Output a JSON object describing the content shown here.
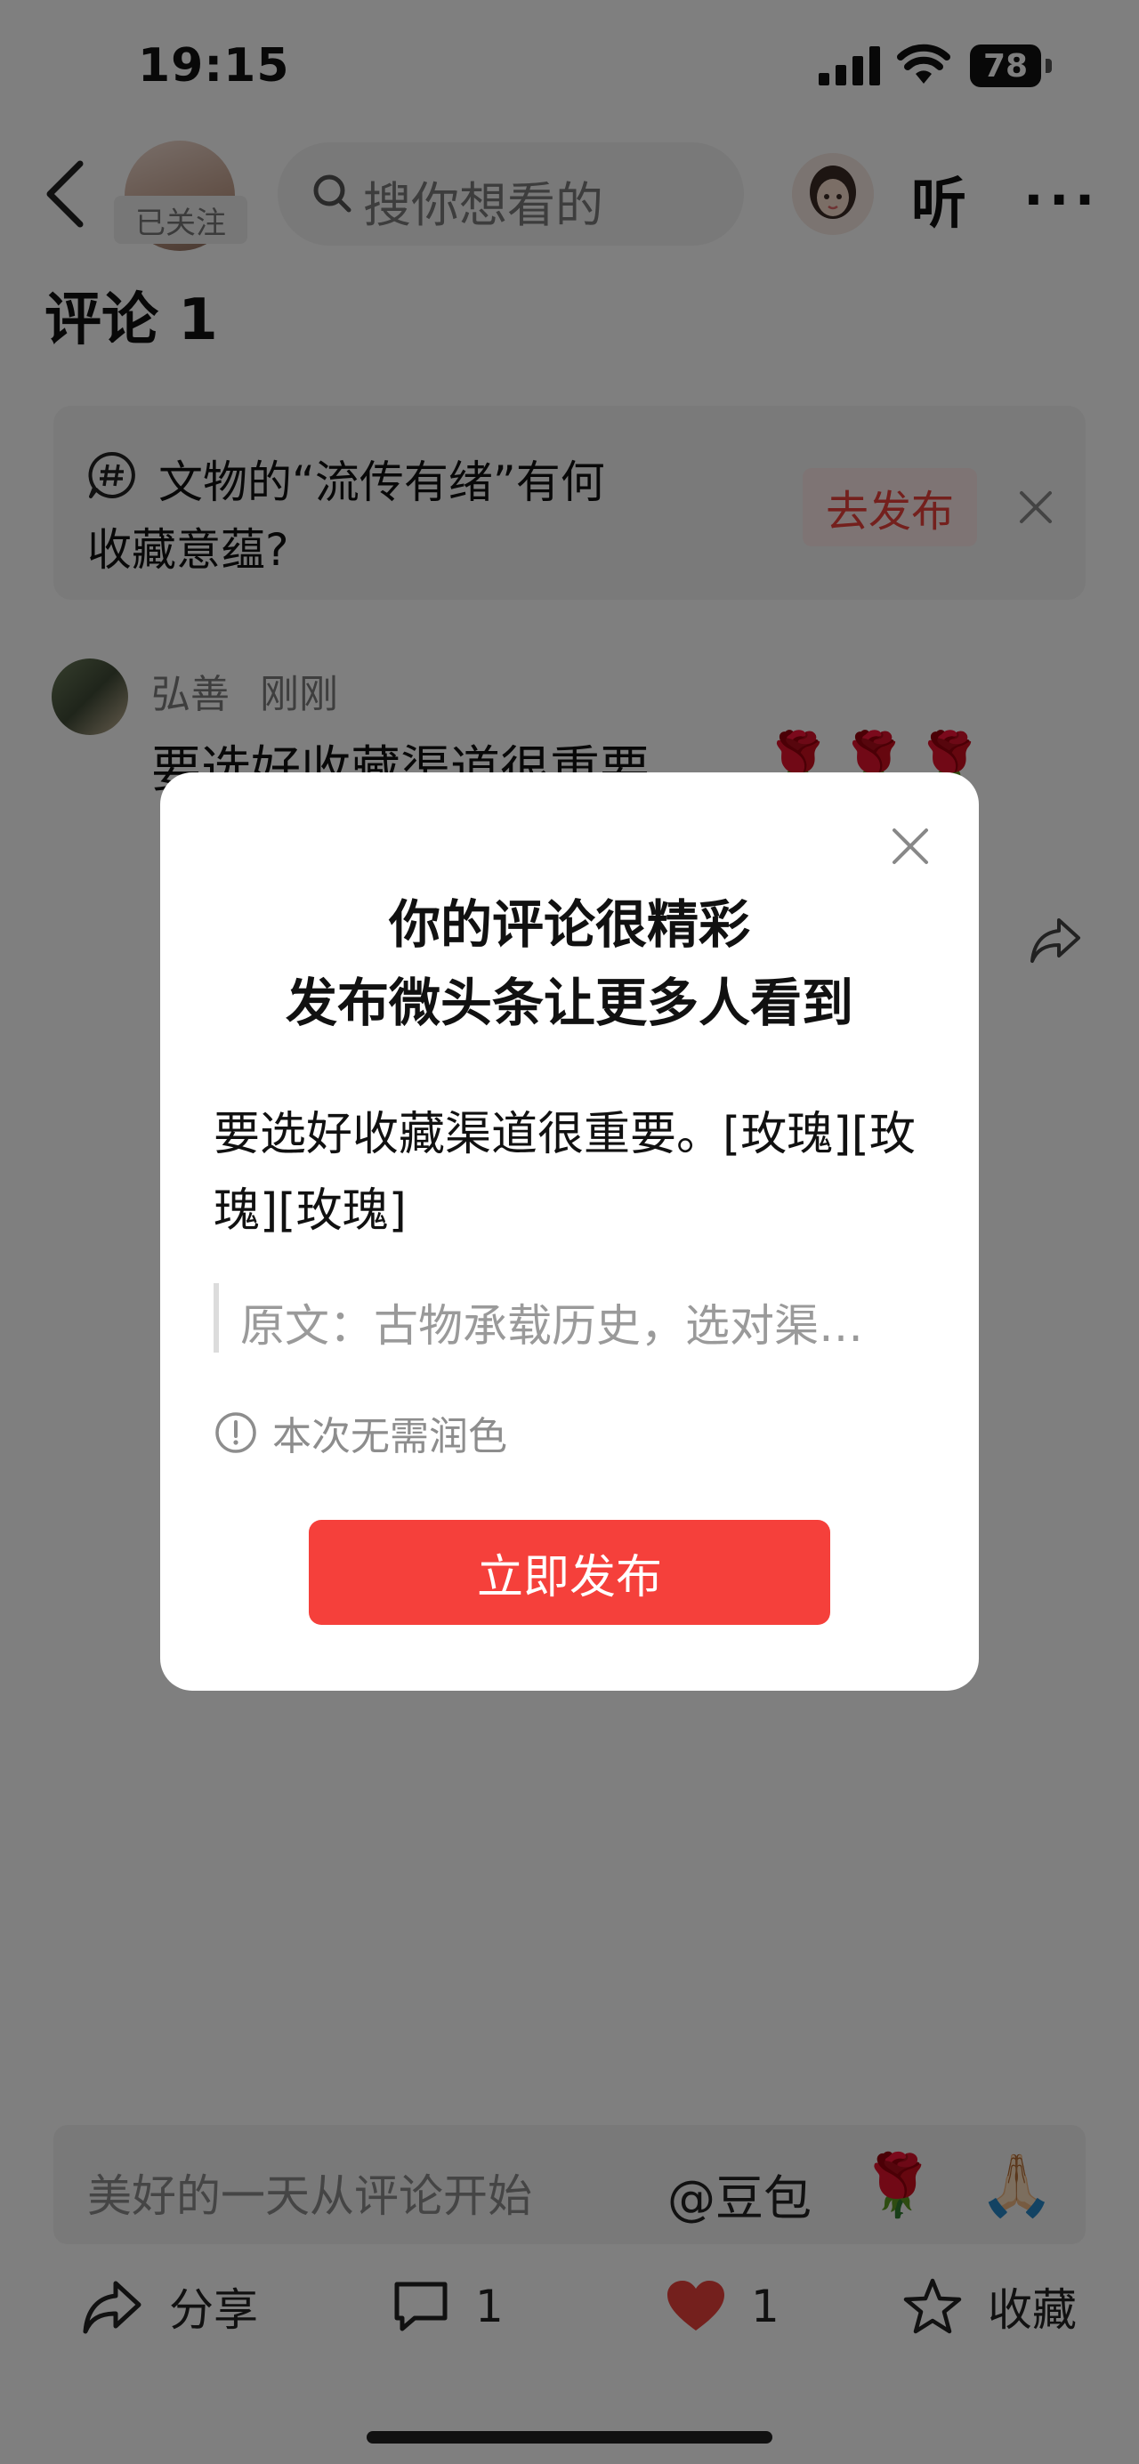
{
  "status_bar": {
    "time": "19:15",
    "battery": "78"
  },
  "header": {
    "follow_label": "已关注",
    "search_placeholder": "搜你想看的",
    "listen_label": "听",
    "more_label": "···"
  },
  "comments": {
    "title": "评论 1"
  },
  "topic": {
    "line1": "文物的“流传有绪”有何",
    "line2": "收藏意蕴?",
    "publish_label": "去发布"
  },
  "comment": {
    "author": "弘善",
    "time": "刚刚",
    "text": "要选好收藏渠道很重要。",
    "emoji": "🌹🌹🌹"
  },
  "input": {
    "placeholder": "美好的一天从评论开始",
    "mention": "@豆包",
    "emoji_rose": "🌹",
    "emoji_pray": "🙏🏻"
  },
  "toolbar": {
    "share_label": "分享",
    "comment_count": "1",
    "like_count": "1",
    "favorite_label": "收藏"
  },
  "modal": {
    "title_line1": "你的评论很精彩",
    "title_line2": "发布微头条让更多人看到",
    "body": "要选好收藏渠道很重要。[玫瑰][玫瑰][玫瑰]",
    "original": "原文：古物承载历史，选对渠…",
    "notice": "本次无需润色",
    "publish_label": "立即发布"
  },
  "colors": {
    "accent": "#f5403b",
    "like": "#e8403a"
  }
}
